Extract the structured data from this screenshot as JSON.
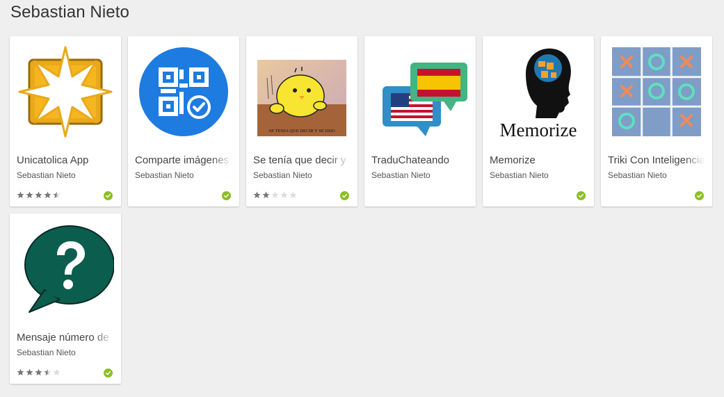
{
  "page": {
    "title": "Sebastian Nieto"
  },
  "colors": {
    "background": "#efefef",
    "card": "#ffffff",
    "check": "#8cbf26",
    "star_on": "#777777",
    "star_off": "#dddddd"
  },
  "apps": [
    {
      "title": "Unicatolica App",
      "developer": "Sebastian Nieto",
      "rating": 4.5,
      "icon": "unicatolica-star-icon",
      "installed": true
    },
    {
      "title": "Comparte imágenes",
      "developer": "Sebastian Nieto",
      "rating": null,
      "icon": "qr-share-icon",
      "installed": true
    },
    {
      "title": "Se tenía que decir y se dijo",
      "developer": "Sebastian Nieto",
      "rating": 2,
      "icon": "yellow-bird-meme-icon",
      "thumb_caption": "SE TENIA QUE DECIR Y SE DIJO",
      "installed": true
    },
    {
      "title": "TraduChateando",
      "developer": "Sebastian Nieto",
      "rating": null,
      "icon": "flags-chat-icon",
      "installed": false
    },
    {
      "title": "Memorize",
      "developer": "Sebastian Nieto",
      "rating": null,
      "icon": "puzzle-head-icon",
      "thumb_caption": "Memorize",
      "installed": true
    },
    {
      "title": "Triki Con Inteligencia",
      "developer": "Sebastian Nieto",
      "rating": null,
      "icon": "tic-tac-toe-icon",
      "installed": true
    },
    {
      "title": "Mensaje número de",
      "developer": "Sebastian Nieto",
      "rating": 3.5,
      "icon": "question-bubble-icon",
      "installed": true
    }
  ]
}
